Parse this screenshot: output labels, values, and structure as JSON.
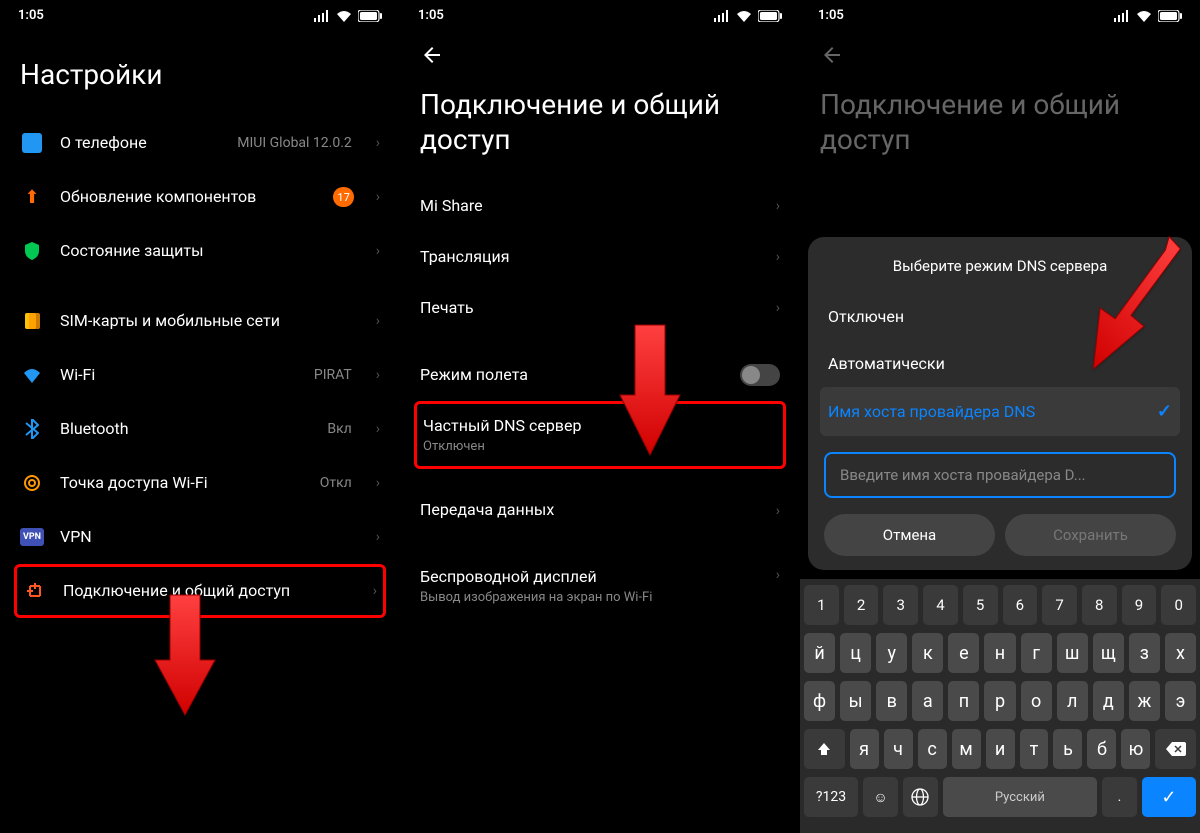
{
  "status": {
    "time": "1:05"
  },
  "screen1": {
    "title": "Настройки",
    "about": {
      "label": "О телефоне",
      "value": "MIUI Global 12.0.2"
    },
    "update": {
      "label": "Обновление компонентов",
      "badge": "17"
    },
    "security": {
      "label": "Состояние защиты"
    },
    "sim": {
      "label": "SIM-карты и мобильные сети"
    },
    "wifi": {
      "label": "Wi-Fi",
      "value": "PIRAT"
    },
    "bluetooth": {
      "label": "Bluetooth",
      "value": "Вкл"
    },
    "hotspot": {
      "label": "Точка доступа Wi-Fi",
      "value": "Откл"
    },
    "vpn": {
      "label": "VPN",
      "icon_text": "VPN"
    },
    "sharing": {
      "label": "Подключение и общий доступ"
    }
  },
  "screen2": {
    "title": "Подключение и общий доступ",
    "mishare": {
      "label": "Mi Share"
    },
    "cast": {
      "label": "Трансляция"
    },
    "print": {
      "label": "Печать"
    },
    "airplane": {
      "label": "Режим полета"
    },
    "dns": {
      "label": "Частный DNS сервер",
      "sub": "Отключен"
    },
    "data": {
      "label": "Передача данных"
    },
    "wireless_display": {
      "label": "Беспроводной дисплей",
      "sub": "Вывод изображения на экран по Wi-Fi"
    }
  },
  "screen3": {
    "title": "Подключение и общий доступ",
    "dialog": {
      "title": "Выберите режим DNS сервера",
      "opt_off": "Отключен",
      "opt_auto": "Автоматически",
      "opt_host": "Имя хоста провайдера DNS",
      "input_placeholder": "Введите имя хоста провайдера D...",
      "cancel": "Отмена",
      "save": "Сохранить"
    },
    "keyboard": {
      "row_num": [
        "1",
        "2",
        "3",
        "4",
        "5",
        "6",
        "7",
        "8",
        "9",
        "0"
      ],
      "row1": [
        "й",
        "ц",
        "у",
        "к",
        "е",
        "н",
        "г",
        "ш",
        "щ",
        "з",
        "х"
      ],
      "row2": [
        "ф",
        "ы",
        "в",
        "а",
        "п",
        "р",
        "о",
        "л",
        "д",
        "ж",
        "э"
      ],
      "row3": [
        "я",
        "ч",
        "с",
        "м",
        "и",
        "т",
        "ь",
        "б",
        "ю"
      ],
      "lang": "Русский",
      "sym": "?123"
    }
  }
}
